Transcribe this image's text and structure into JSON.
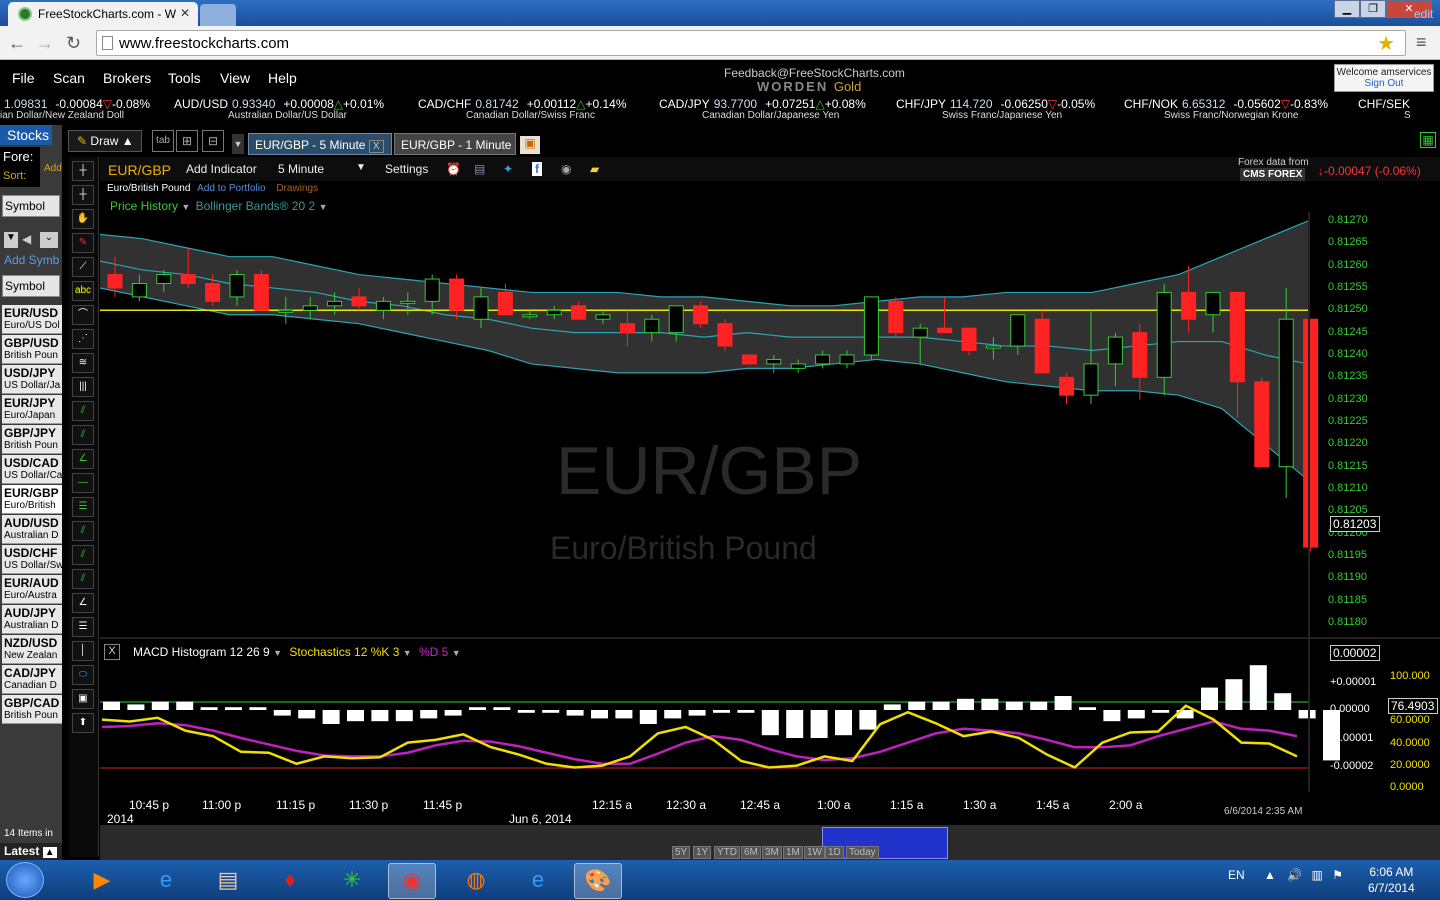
{
  "browser": {
    "tab_title": "FreeStockCharts.com - W",
    "url": "www.freestockcharts.com"
  },
  "menu": [
    "File",
    "Scan",
    "Brokers",
    "Tools",
    "View",
    "Help"
  ],
  "header": {
    "feedback": "Feedback@FreeStockCharts.com",
    "brand": "WORDEN",
    "brand_suffix": "Gold",
    "welcome": "Welcome amservices",
    "sign_out": "Sign Out"
  },
  "ticker": [
    {
      "sym": "",
      "val": "1.09831",
      "chg": "-0.00084",
      "pct": "-0.08%",
      "dir": "dn",
      "name": "ian Dollar/New Zealand Doll"
    },
    {
      "sym": "AUD/USD",
      "val": "0.93340",
      "chg": "+0.00008",
      "pct": "+0.01%",
      "dir": "up",
      "name": "Australian Dollar/US Dollar"
    },
    {
      "sym": "CAD/CHF",
      "val": "0.81742",
      "chg": "+0.00112",
      "pct": "+0.14%",
      "dir": "up",
      "name": "Canadian Dollar/Swiss Franc"
    },
    {
      "sym": "CAD/JPY",
      "val": "93.7700",
      "chg": "+0.07251",
      "pct": "+0.08%",
      "dir": "up",
      "name": "Canadian Dollar/Japanese Yen"
    },
    {
      "sym": "CHF/JPY",
      "val": "114.720",
      "chg": "-0.06250",
      "pct": "-0.05%",
      "dir": "dn",
      "name": "Swiss Franc/Japanese Yen"
    },
    {
      "sym": "CHF/NOK",
      "val": "6.65312",
      "chg": "-0.05602",
      "pct": "-0.83%",
      "dir": "dn",
      "name": "Swiss Franc/Norwegian Krone"
    },
    {
      "sym": "CHF/SEK",
      "val": "",
      "chg": "",
      "pct": "",
      "dir": "",
      "name": "S"
    }
  ],
  "ticker_edit": "edit",
  "left": {
    "tab": "Stocks",
    "forex": "Fore:",
    "sort": "Sort:",
    "add": "Add Co",
    "symbol_header": "Symbol",
    "add_symbol": "Add Symb",
    "symbol_header2": "Symbol",
    "items": [
      {
        "sym": "EUR/USD",
        "name": "Euro/US Dol"
      },
      {
        "sym": "GBP/USD",
        "name": "British Poun"
      },
      {
        "sym": "USD/JPY",
        "name": "US Dollar/Ja"
      },
      {
        "sym": "EUR/JPY",
        "name": "Euro/Japan"
      },
      {
        "sym": "GBP/JPY",
        "name": "British Poun"
      },
      {
        "sym": "USD/CAD",
        "name": "US Dollar/Ca"
      },
      {
        "sym": "EUR/GBP",
        "name": "Euro/British"
      },
      {
        "sym": "AUD/USD",
        "name": "Australian D"
      },
      {
        "sym": "USD/CHF",
        "name": "US Dollar/Sw"
      },
      {
        "sym": "EUR/AUD",
        "name": "Euro/Austra"
      },
      {
        "sym": "AUD/JPY",
        "name": "Australian D"
      },
      {
        "sym": "NZD/USD",
        "name": "New Zealan"
      },
      {
        "sym": "CAD/JPY",
        "name": "Canadian D"
      },
      {
        "sym": "GBP/CAD",
        "name": "British Poun"
      }
    ],
    "items_count": "14 Items in",
    "latest": "Latest"
  },
  "chart_tabs": {
    "draw": "Draw",
    "tab_label": "tab",
    "tab1": "EUR/GBP - 5 Minute",
    "tab2": "EUR/GBP - 1 Minute"
  },
  "chart_header": {
    "symbol": "EUR/GBP",
    "add_indicator": "Add Indicator",
    "interval": "5 Minute",
    "settings": "Settings",
    "full_name": "Euro/British Pound",
    "add_portfolio": "Add to Portfolio",
    "drawings": "Drawings",
    "price_history": "Price History",
    "bollinger": "Bollinger Bands® 20 2",
    "forex_from": "Forex data from",
    "cms": "CMS FOREX",
    "change": "-0.00047 (-0.06%)"
  },
  "watermark": {
    "symbol": "EUR/GBP",
    "name": "Euro/British Pound"
  },
  "lower_pane": {
    "macd": "MACD Histogram 12 26 9",
    "stoch": "Stochastics 12 %K 3",
    "pctd": "%D 5",
    "macd_value": "0.00002",
    "stoch_value": "76.4903"
  },
  "date_stamp": "6/6/2014 2:35 AM",
  "zoom": [
    "5Y",
    "1Y",
    "YTD",
    "6M",
    "3M",
    "1M",
    "1W",
    "1D",
    "Today"
  ],
  "taskbar": {
    "lang": "EN",
    "time": "6:06 AM",
    "date": "6/7/2014"
  },
  "chart_data": {
    "type": "candlestick",
    "title": "EUR/GBP",
    "interval": "5 Minute",
    "ylim": [
      0.81178,
      0.81272
    ],
    "yticks": [
      "0.81270",
      "0.81265",
      "0.81260",
      "0.81255",
      "0.81250",
      "0.81245",
      "0.81240",
      "0.81235",
      "0.81230",
      "0.81225",
      "0.81220",
      "0.81215",
      "0.81210",
      "0.81205",
      "0.81200",
      "0.81195",
      "0.81190",
      "0.81185",
      "0.81180"
    ],
    "last_price": "0.81203",
    "horizontal_line": 0.8125,
    "xticks": [
      "10:45 p",
      "11:00 p",
      "11:15 p",
      "11:30 p",
      "11:45 p",
      "12:15 a",
      "12:30 a",
      "12:45 a",
      "1:00 a",
      "1:15 a",
      "1:30 a",
      "1:45 a",
      "2:00 a"
    ],
    "xdates": [
      "2014",
      "Jun 6, 2014"
    ],
    "candles": [
      [
        0.81258,
        0.81262,
        0.81253,
        0.81255
      ],
      [
        0.81253,
        0.81258,
        0.81252,
        0.81256
      ],
      [
        0.81256,
        0.81259,
        0.81254,
        0.81258
      ],
      [
        0.81258,
        0.81264,
        0.81255,
        0.81256
      ],
      [
        0.81256,
        0.81258,
        0.81251,
        0.81252
      ],
      [
        0.81253,
        0.81259,
        0.81251,
        0.81258
      ],
      [
        0.81258,
        0.81259,
        0.8125,
        0.8125
      ],
      [
        0.8125,
        0.81253,
        0.81247,
        0.8125
      ],
      [
        0.8125,
        0.81253,
        0.81248,
        0.81251
      ],
      [
        0.81251,
        0.81254,
        0.81249,
        0.81252
      ],
      [
        0.81253,
        0.81255,
        0.8125,
        0.81251
      ],
      [
        0.8125,
        0.81253,
        0.81248,
        0.81252
      ],
      [
        0.81252,
        0.81254,
        0.81249,
        0.81252
      ],
      [
        0.81252,
        0.81258,
        0.81249,
        0.81257
      ],
      [
        0.81257,
        0.81258,
        0.81248,
        0.8125
      ],
      [
        0.81248,
        0.81255,
        0.81246,
        0.81253
      ],
      [
        0.81254,
        0.81256,
        0.81249,
        0.81249
      ],
      [
        0.81249,
        0.8125,
        0.81248,
        0.81249
      ],
      [
        0.81249,
        0.81251,
        0.81248,
        0.8125
      ],
      [
        0.81251,
        0.81252,
        0.81248,
        0.81248
      ],
      [
        0.81248,
        0.8125,
        0.81247,
        0.81249
      ],
      [
        0.81247,
        0.8125,
        0.81242,
        0.81245
      ],
      [
        0.81245,
        0.81249,
        0.81243,
        0.81248
      ],
      [
        0.81245,
        0.81251,
        0.81243,
        0.81251
      ],
      [
        0.81251,
        0.81252,
        0.81246,
        0.81247
      ],
      [
        0.81247,
        0.81248,
        0.81241,
        0.81242
      ],
      [
        0.8124,
        0.8124,
        0.81238,
        0.81238
      ],
      [
        0.81238,
        0.8124,
        0.81236,
        0.81239
      ],
      [
        0.81237,
        0.81239,
        0.81236,
        0.81238
      ],
      [
        0.81238,
        0.81241,
        0.81237,
        0.8124
      ],
      [
        0.81238,
        0.81241,
        0.81237,
        0.8124
      ],
      [
        0.8124,
        0.81253,
        0.81239,
        0.81253
      ],
      [
        0.81252,
        0.81253,
        0.81244,
        0.81245
      ],
      [
        0.81244,
        0.81247,
        0.81238,
        0.81246
      ],
      [
        0.81246,
        0.81253,
        0.81245,
        0.81245
      ],
      [
        0.81246,
        0.81246,
        0.8124,
        0.81241
      ],
      [
        0.81242,
        0.81244,
        0.81239,
        0.81242
      ],
      [
        0.81242,
        0.81249,
        0.8124,
        0.81249
      ],
      [
        0.81248,
        0.8125,
        0.81236,
        0.81236
      ],
      [
        0.81235,
        0.81236,
        0.81229,
        0.81231
      ],
      [
        0.81231,
        0.8125,
        0.81229,
        0.81238
      ],
      [
        0.81238,
        0.81245,
        0.81233,
        0.81244
      ],
      [
        0.81245,
        0.81247,
        0.8123,
        0.81235
      ],
      [
        0.81235,
        0.81256,
        0.81231,
        0.81254
      ],
      [
        0.81254,
        0.8126,
        0.81245,
        0.81248
      ],
      [
        0.81249,
        0.81253,
        0.81245,
        0.81254
      ],
      [
        0.81254,
        0.81254,
        0.81226,
        0.81234
      ],
      [
        0.81234,
        0.81235,
        0.81215,
        0.81215
      ],
      [
        0.81215,
        0.81255,
        0.81208,
        0.81248
      ],
      [
        0.81248,
        0.81248,
        0.81196,
        0.81197
      ]
    ],
    "bollinger": {
      "upper": [
        0.81267,
        0.81266,
        0.81264,
        0.81262,
        0.81262,
        0.8126,
        0.81258,
        0.81257,
        0.81256,
        0.81255,
        0.81254,
        0.81254,
        0.81254,
        0.81253,
        0.81253,
        0.81252,
        0.81251,
        0.81251,
        0.81252,
        0.81253,
        0.81253,
        0.81254,
        0.81254,
        0.81254,
        0.81256,
        0.81258,
        0.81262,
        0.81266,
        0.8127
      ],
      "lower": [
        0.81255,
        0.81253,
        0.81251,
        0.81249,
        0.81249,
        0.81248,
        0.81247,
        0.81245,
        0.81243,
        0.81241,
        0.81238,
        0.81237,
        0.81236,
        0.81236,
        0.81236,
        0.81237,
        0.81237,
        0.81238,
        0.81239,
        0.81238,
        0.81236,
        0.81234,
        0.81233,
        0.81232,
        0.81232,
        0.81231,
        0.81228,
        0.8122,
        0.81212
      ],
      "middle": [
        0.81261,
        0.81259,
        0.81258,
        0.81256,
        0.81255,
        0.81254,
        0.81252,
        0.81251,
        0.81249,
        0.81248,
        0.81246,
        0.81245,
        0.81245,
        0.81245,
        0.81244,
        0.81245,
        0.81244,
        0.81244,
        0.81244,
        0.81244,
        0.81243,
        0.81242,
        0.81242,
        0.81241,
        0.81242,
        0.81243,
        0.81243,
        0.8124,
        0.81238
      ]
    },
    "macd_hist": [
      3e-06,
      2e-06,
      3e-06,
      3e-06,
      1e-06,
      1e-06,
      1e-06,
      -2e-06,
      -3e-06,
      -5e-06,
      -4e-06,
      -4e-06,
      -4e-06,
      -3e-06,
      -2e-06,
      1e-06,
      1e-06,
      -1e-06,
      -1e-06,
      -2e-06,
      -3e-06,
      -3e-06,
      -5e-06,
      -3e-06,
      -2e-06,
      -1e-06,
      -1e-06,
      -9e-06,
      -1e-05,
      -1e-05,
      -9e-06,
      -7e-06,
      2e-06,
      3e-06,
      3e-06,
      4e-06,
      4e-06,
      3e-06,
      3e-06,
      5e-06,
      1e-06,
      -4e-06,
      -3e-06,
      -1e-06,
      -3e-06,
      8e-06,
      1.1e-05,
      1.6e-05,
      6e-06,
      -3e-06,
      -1.8e-05
    ],
    "stoch_k": [
      70,
      68,
      72,
      58,
      52,
      35,
      34,
      22,
      30,
      28,
      29,
      45,
      48,
      54,
      40,
      32,
      22,
      18,
      20,
      30,
      55,
      62,
      48,
      25,
      18,
      20,
      30,
      25,
      65,
      78,
      66,
      52,
      57,
      50,
      32,
      18,
      45,
      56,
      57,
      85,
      70,
      45,
      44,
      30
    ],
    "stoch_d": [
      62,
      63,
      66,
      64,
      58,
      50,
      43,
      36,
      31,
      30,
      30,
      34,
      42,
      47,
      46,
      41,
      34,
      27,
      22,
      22,
      33,
      45,
      52,
      48,
      38,
      30,
      26,
      28,
      35,
      45,
      55,
      60,
      58,
      55,
      48,
      40,
      40,
      42,
      52,
      60,
      68,
      60,
      58,
      52
    ]
  }
}
